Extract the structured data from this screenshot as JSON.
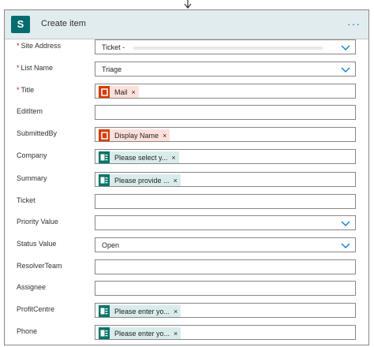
{
  "card": {
    "title": "Create item",
    "more": "···"
  },
  "fields": [
    {
      "label": "Site Address",
      "required": true,
      "value": "Ticket -",
      "masked": true,
      "dropdown": true
    },
    {
      "label": "List Name",
      "required": true,
      "value": "Triage",
      "dropdown": true
    },
    {
      "label": "Title",
      "required": true,
      "token": {
        "text": "Mail",
        "icon": "office-icon",
        "color": "#d83b01"
      }
    },
    {
      "label": "EditItem"
    },
    {
      "label": "SubmittedBy",
      "token": {
        "text": "Display Name",
        "icon": "office-icon",
        "color": "#d83b01"
      }
    },
    {
      "label": "Company",
      "token": {
        "text": "Please select y...",
        "icon": "forms-icon",
        "color": "#077568"
      }
    },
    {
      "label": "Summary",
      "token": {
        "text": "Please provide ...",
        "icon": "forms-icon",
        "color": "#077568"
      }
    },
    {
      "label": "Ticket"
    },
    {
      "label": "Priority Value",
      "dropdown": true
    },
    {
      "label": "Status Value",
      "value": "Open",
      "dropdown": true
    },
    {
      "label": "ResolverTeam"
    },
    {
      "label": "Assignee"
    },
    {
      "label": "ProfitCentre",
      "token": {
        "text": "Please enter yo...",
        "icon": "forms-icon",
        "color": "#077568"
      }
    },
    {
      "label": "Phone",
      "token": {
        "text": "Please enter yo...",
        "icon": "forms-icon",
        "color": "#077568"
      }
    }
  ],
  "token_remove": "×",
  "required_marker": "*",
  "accent_color": "#0078d4"
}
